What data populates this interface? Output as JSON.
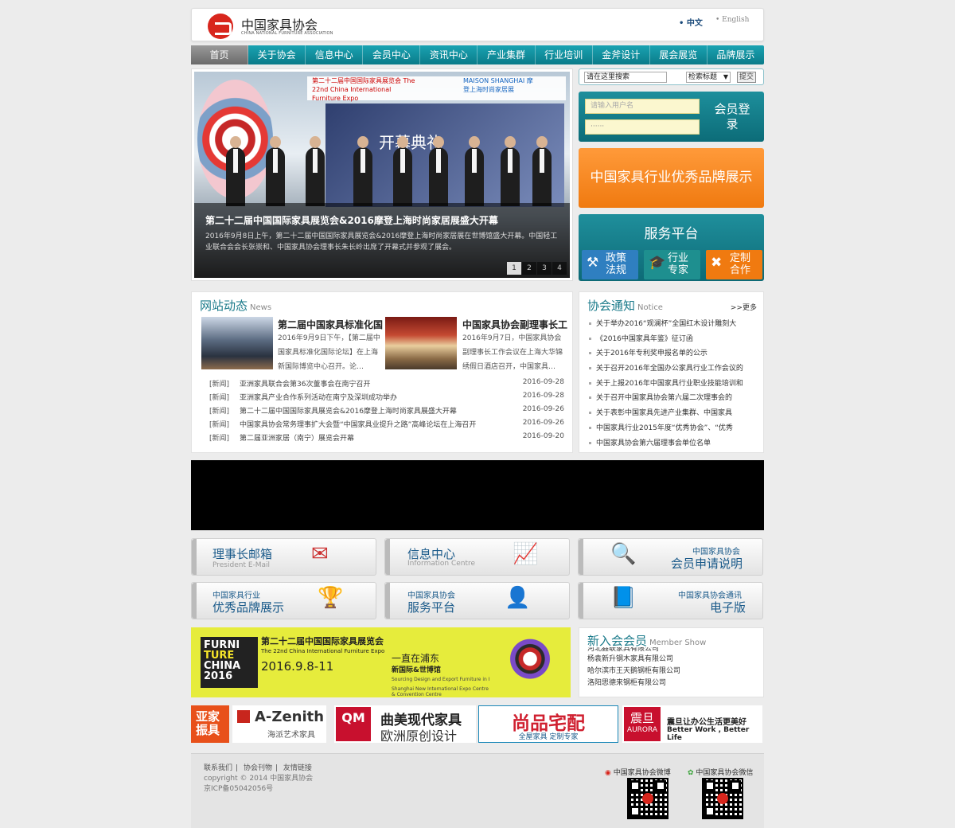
{
  "header": {
    "logo_cn": "中国家具协会",
    "logo_en": "CHINA NATIONAL FURNITURE ASSOCIATION",
    "lang_zh": "• 中文",
    "lang_en": "• English"
  },
  "nav": [
    "首页",
    "关于协会",
    "信息中心",
    "会员中心",
    "资讯中心",
    "产业集群",
    "行业培训",
    "金斧设计",
    "展会展览",
    "品牌展示"
  ],
  "hero": {
    "banner_left": "第二十二届中国国际家具展览会 The 22nd China International Furniture Expo",
    "banner_right": "MAISON SHANGHAI 摩登上海时尚家居展",
    "backdrop_text": "开幕典礼",
    "title": "第二十二届中国国际家具展览会&2016摩登上海时尚家居展盛大开幕",
    "desc": "2016年9月8日上午，第二十二届中国国际家具展览会&2016摩登上海时尚家居展在世博馆盛大开幕。中国轻工业联合会会长张崇和、中国家具协会理事长朱长岭出席了开幕式并参观了展会。",
    "pages": [
      "1",
      "2",
      "3",
      "4"
    ]
  },
  "search": {
    "placeholder": "请在这里搜索",
    "select": "检索标题",
    "submit": "提交"
  },
  "login": {
    "user_placeholder": "请输入用户名",
    "pass_mask": "······",
    "btn": "会员登录"
  },
  "brand_button": "中国家具行业优秀品牌展示",
  "service": {
    "title": "服务平台",
    "items": [
      {
        "line1": "政策",
        "line2": "法规",
        "color": "#2f7fc0",
        "icon": "gavel-icon"
      },
      {
        "line1": "行业",
        "line2": "专家",
        "color": "#1e8f8f",
        "icon": "graduation-cap-icon"
      },
      {
        "line1": "定制",
        "line2": "合作",
        "color": "#f07a10",
        "icon": "tools-icon"
      }
    ]
  },
  "news": {
    "title": "网站动态",
    "title_en": "News",
    "features": [
      {
        "title": "第二届中国家具标准化国",
        "desc": "2016年9月9日下午，【第二届中国家具标准化国际论坛】在上海新国际博览中心召开。论…"
      },
      {
        "title": "中国家具协会副理事长工",
        "desc": "2016年9月7日，中国家具协会副理事长工作会议在上海大华锦绣假日酒店召开，中国家具…"
      }
    ],
    "items": [
      {
        "tag": "[新闻]",
        "text": "亚洲家具联合会第36次董事会在南宁召开",
        "date": "2016-09-28"
      },
      {
        "tag": "[新闻]",
        "text": "亚洲家具产业合作系列活动在南宁及深圳成功举办",
        "date": "2016-09-28"
      },
      {
        "tag": "[新闻]",
        "text": "第二十二届中国国际家具展览会&2016摩登上海时尚家具展盛大开幕",
        "date": "2016-09-26"
      },
      {
        "tag": "[新闻]",
        "text": "中国家具协会常务理事扩大会暨“中国家具业提升之路”高峰论坛在上海召开",
        "date": "2016-09-26"
      },
      {
        "tag": "[新闻]",
        "text": "第二届亚洲家居（南宁）展览会开幕",
        "date": "2016-09-20"
      }
    ]
  },
  "notice": {
    "title": "协会通知",
    "title_en": "Notice",
    "more": ">>更多",
    "items": [
      "关于举办2016“观澜杯”全国红木设计雕刻大",
      "《2016中国家具年鉴》征订函",
      "关于2016年专利奖申报名单的公示",
      "关于召开2016年全国办公家具行业工作会议的",
      "关于上报2016年中国家具行业职业技能培训和",
      "关于召开中国家具协会第六届二次理事会的",
      "关于表彰中国家具先进产业集群、中国家具",
      "中国家具行业2015年度“优秀协会”、“优秀",
      "中国家具协会第六届理事会单位名单"
    ]
  },
  "tiles": [
    {
      "big": "理事长邮箱",
      "small": "President E-Mail",
      "icon": "mail-envelope-icon"
    },
    {
      "big": "信息中心",
      "small": "Information Centre",
      "icon": "chart-notebook-icon"
    },
    {
      "sub": "中国家具协会",
      "big": "会员申请说明",
      "icon": "magnifier-icon"
    },
    {
      "sub": "中国家具行业",
      "big": "优秀品牌展示",
      "icon": "trophy-icon"
    },
    {
      "sub": "中国家具协会",
      "big": "服务平台",
      "icon": "support-agent-icon"
    },
    {
      "sub": "中国家具协会通讯",
      "big": "电子版",
      "icon": "book-icon"
    }
  ],
  "expo": {
    "logo_l1": "FURNI",
    "logo_l2": "TURE",
    "logo_l3": "CHINA",
    "logo_l4": "2016",
    "title": "第二十二届中国国际家具展览会",
    "title_en": "The 22nd China International Furniture Expo",
    "date": "2016.9.8-11",
    "slogan": "一直在浦东",
    "venues": "新国际&世博馆",
    "line1": "Sourcing Design and Export Furniture in Pudong",
    "line2": "Shanghai New International Expo Centre / Shanghai World Expo Exhibition & Convention Centre"
  },
  "members": {
    "title": "新入会会员",
    "title_en": "Member Show",
    "items": [
      "河北鑫联家具有限公司",
      "杨袁新升钢木家具有限公司",
      "哈尔滨市王天鹅钢柜有限公司",
      "洛阳思德来钢柜有限公司"
    ]
  },
  "brands": [
    {
      "name": "亚家振具",
      "bg": "#e8501a"
    },
    {
      "name": "A-Zenith",
      "sub": "海派艺术家具"
    },
    {
      "name": "曲美现代家具",
      "sub": "欧洲原创设计",
      "mark": "QM"
    },
    {
      "name": "尚品宅配",
      "sub": "全屋家具 定制专家"
    },
    {
      "name": "震旦",
      "en": "AURORA",
      "tag": "震旦让办公生活更美好",
      "tag_en": "Better Work , Better Life"
    }
  ],
  "footer": {
    "links": [
      "联系我们",
      "协会刊物",
      "友情链接"
    ],
    "copyright": "copyright © 2014 中国家具协会",
    "icp": "京ICP备05042056号",
    "weibo": "中国家具协会微博",
    "wechat": "中国家具协会微信"
  }
}
